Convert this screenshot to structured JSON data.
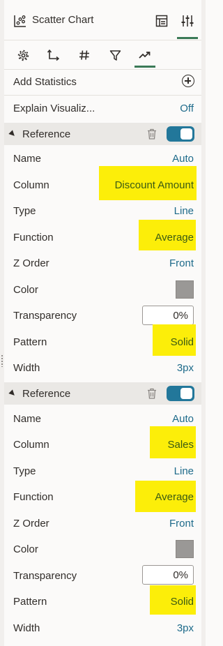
{
  "header": {
    "title": "Scatter Chart",
    "buttons": [
      {
        "name": "layout-icon",
        "active": false
      },
      {
        "name": "properties-icon",
        "active": true
      }
    ]
  },
  "tabs": [
    {
      "name": "general-tab-icon",
      "active": false
    },
    {
      "name": "axis-tab-icon",
      "active": false
    },
    {
      "name": "values-tab-icon",
      "active": false
    },
    {
      "name": "filter-tab-icon",
      "active": false
    },
    {
      "name": "analytics-tab-icon",
      "active": true
    }
  ],
  "statistics": {
    "add_label": "Add Statistics",
    "explain_label": "Explain Visualiz...",
    "explain_value": "Off"
  },
  "references": [
    {
      "title": "Reference",
      "enabled": true,
      "rows": {
        "name_label": "Name",
        "name_value": "Auto",
        "column_label": "Column",
        "column_value": "Discount Amount",
        "type_label": "Type",
        "type_value": "Line",
        "function_label": "Function",
        "function_value": "Average",
        "zorder_label": "Z Order",
        "zorder_value": "Front",
        "color_label": "Color",
        "color_value": "#9a9896",
        "transparency_label": "Transparency",
        "transparency_value": "0%",
        "pattern_label": "Pattern",
        "pattern_value": "Solid",
        "width_label": "Width",
        "width_value": "3px"
      }
    },
    {
      "title": "Reference",
      "enabled": true,
      "rows": {
        "name_label": "Name",
        "name_value": "Auto",
        "column_label": "Column",
        "column_value": "Sales",
        "type_label": "Type",
        "type_value": "Line",
        "function_label": "Function",
        "function_value": "Average",
        "zorder_label": "Z Order",
        "zorder_value": "Front",
        "color_label": "Color",
        "color_value": "#9a9896",
        "transparency_label": "Transparency",
        "transparency_value": "0%",
        "pattern_label": "Pattern",
        "pattern_value": "Solid",
        "width_label": "Width",
        "width_value": "3px"
      }
    }
  ],
  "colors": {
    "accent_green": "#3b7a57",
    "link_blue": "#1d6a8a",
    "toggle_blue": "#22779a",
    "highlight_yellow": "#fcee09"
  }
}
